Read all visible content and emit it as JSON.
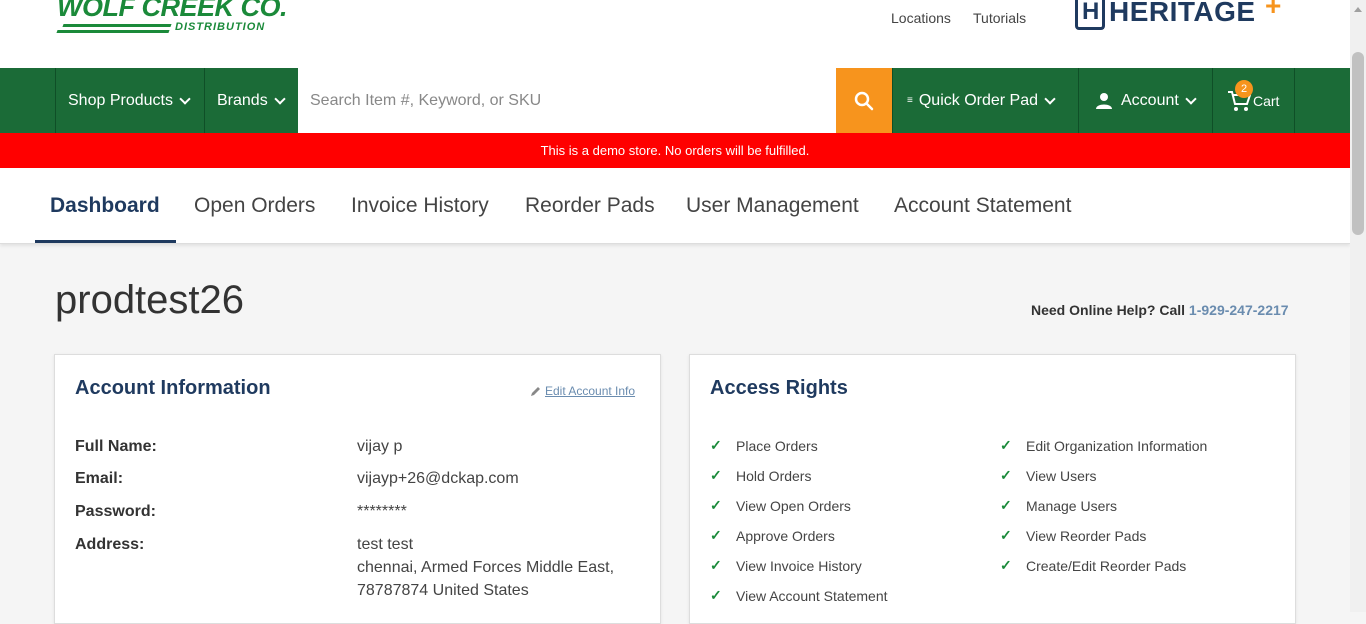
{
  "brand": {
    "name": "WOLF CREEK CO.",
    "sub": "DISTRIBUTION",
    "partner": "HERITAGE"
  },
  "top_links": [
    "Locations",
    "Tutorials"
  ],
  "nav": {
    "shop": "Shop Products",
    "brands": "Brands",
    "search_placeholder": "Search Item #, Keyword, or SKU",
    "quick_order": "Quick Order Pad",
    "account": "Account",
    "cart": "Cart",
    "cart_count": "2"
  },
  "banner": "This is a demo store. No orders will be fulfilled.",
  "tabs": [
    "Dashboard",
    "Open Orders",
    "Invoice History",
    "Reorder Pads",
    "User Management",
    "Account Statement"
  ],
  "page_title": "prodtest26",
  "help": {
    "text": "Need Online Help? Call",
    "phone": "1-929-247-2217"
  },
  "account_info": {
    "title": "Account Information",
    "edit": "Edit Account Info",
    "labels": [
      "Full Name:",
      "Email:",
      "Password:",
      "Address:"
    ],
    "full_name": "vijay p",
    "email": "vijayp+26@dckap.com",
    "password": "********",
    "address": [
      "test test",
      "chennai, Armed Forces Middle East,",
      "78787874 United States"
    ]
  },
  "access_rights": {
    "title": "Access Rights",
    "left": [
      "Place Orders",
      "Hold Orders",
      "View Open Orders",
      "Approve Orders",
      "View Invoice History",
      "View Account Statement"
    ],
    "right": [
      "Edit Organization Information",
      "View Users",
      "Manage Users",
      "View Reorder Pads",
      "Create/Edit Reorder Pads"
    ]
  },
  "colors": {
    "green": "#1b6b37",
    "orange": "#f7941d",
    "navy": "#1f3a5f",
    "red": "#ff0000"
  }
}
